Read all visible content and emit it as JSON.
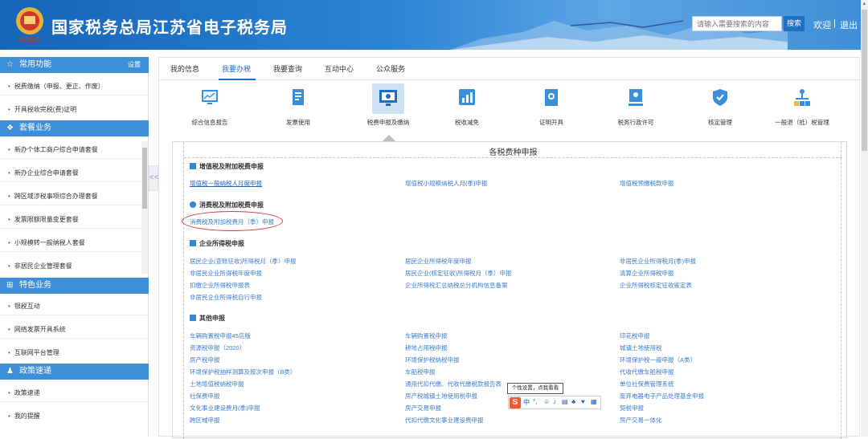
{
  "header": {
    "title": "国家税务总局江苏省电子税务局",
    "logo_text": "中国税务",
    "search_placeholder": "请输入需要搜索的内容",
    "search_button": "搜索",
    "welcome": "欢迎",
    "separator": "|",
    "logout": "退出",
    "colors": {
      "primary": "#1e6fc6",
      "header_bg": "#2b83d4"
    }
  },
  "sidebar": {
    "sections": [
      {
        "title": "常用功能",
        "icon": "star-icon",
        "action": "设置",
        "items": [
          "税费缴纳（申报、更正、作废）",
          "开具税收完税(费)证明"
        ]
      },
      {
        "title": "套餐业务",
        "icon": "layers-icon",
        "items": [
          "新办个体工商户综合申请套餐",
          "新办企业综合申请套餐",
          "跨区域涉税事项综合办理套餐",
          "发票限额限量变更套餐",
          "小规模转一般纳税人套餐",
          "非居民企业管理套餐"
        ]
      },
      {
        "title": "特色业务",
        "icon": "grid-icon",
        "items": [
          "银税互动",
          "网络发票开具系统",
          "互联网平台管理"
        ]
      },
      {
        "title": "政策速递",
        "icon": "person-icon",
        "items": [
          "政策速递",
          "我的提醒"
        ]
      }
    ],
    "collapse_label": "<<"
  },
  "tabs": [
    "我的信息",
    "我要办税",
    "我要查询",
    "互动中心",
    "公众服务"
  ],
  "active_tab": "我要办税",
  "categories": [
    {
      "label": "综合信息报告",
      "icon": "chart-monitor-icon"
    },
    {
      "label": "发票使用",
      "icon": "invoice-icon"
    },
    {
      "label": "税费申报及缴纳",
      "icon": "monitor-icon"
    },
    {
      "label": "税收减免",
      "icon": "bar-chart-icon"
    },
    {
      "label": "证明开具",
      "icon": "certificate-icon"
    },
    {
      "label": "税务行政许可",
      "icon": "badge-icon"
    },
    {
      "label": "核定管理",
      "icon": "shield-icon"
    },
    {
      "label": "一般退（抵）税管理",
      "icon": "org-icon"
    }
  ],
  "panel": {
    "title": "各税费种申报",
    "groups": [
      {
        "name": "增值税及附加税费申报",
        "links": [
          "增值税一般纳税人月度申报",
          "增值税小规模纳税人月(季)申报",
          "增值税预缴税款申报"
        ]
      },
      {
        "name": "消费税及附加税费申报",
        "links": [
          "消费税及附加税费月（季）申报"
        ]
      },
      {
        "name": "企业所得税申报",
        "links": [
          "居民企业(查账征收)所得税月（季）申报",
          "居民企业所得税年度申报",
          "非居民企业所得税月(季)申报",
          "非居民企业所得税年度申报",
          "居民企业(核定征收)所得税月（季）申报",
          "清算企业所得税申报",
          "扣缴企业所得税申报表",
          "企业所得税汇总纳税总分机构信息备案",
          "企业所得税核定征收鉴定表",
          "非居民企业所得税自行申报"
        ]
      },
      {
        "name": "其他申报",
        "links": [
          "车辆购置税申报45店版",
          "车辆购置税申报",
          "印花税申报",
          "资源税申报（2020）",
          "耕地占用税申报",
          "城镇土地使用税",
          "房产税申报",
          "环境保护税纳税申报",
          "环境保护税一般申报（A类）",
          "环境保护税抽样测算及按次申报（B类）",
          "车船税申报",
          "代收代缴车船税申报",
          "土地增值税纳税申报",
          "通用代扣代缴、代收代缴税款报告表",
          "单位社保费管理系统",
          "社保费申报",
          "房产税城镇土地使用税申报",
          "废弃电器电子产品处理基金申报",
          "文化事业建设费月(季)申报",
          "房产交易申报",
          "契税申报",
          "跨区域申报",
          "代扣代缴文化事业建设费申报",
          "房产交易一体化"
        ]
      }
    ]
  },
  "ime": {
    "tooltip": "个性设置，点我看看",
    "mode": "中",
    "logo": "S"
  }
}
